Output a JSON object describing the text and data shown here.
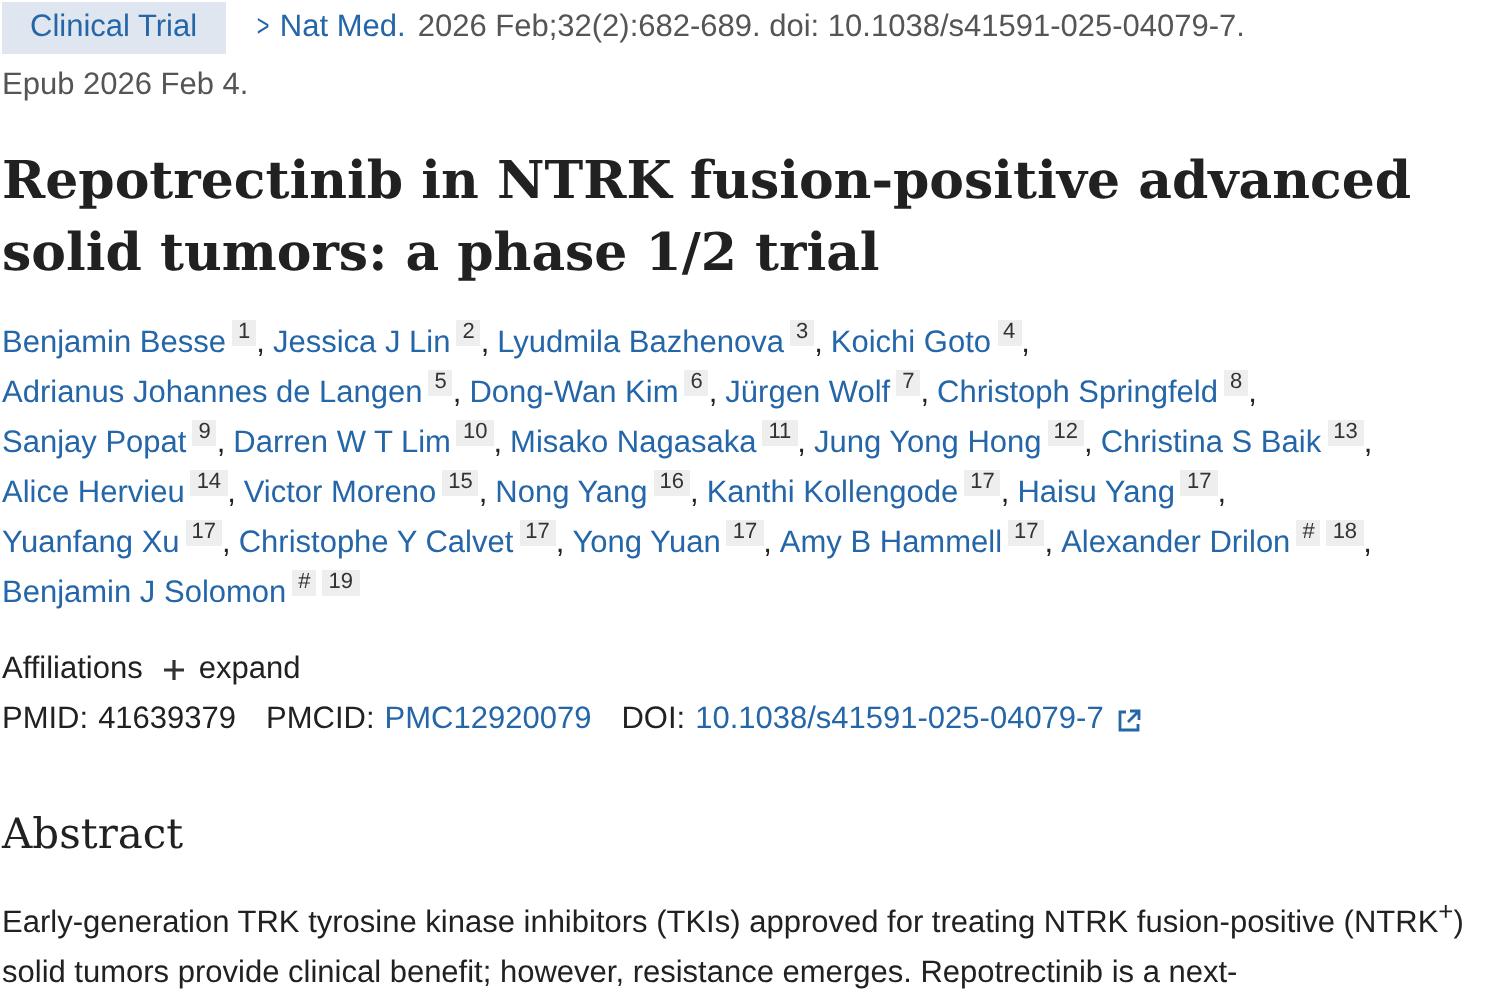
{
  "header": {
    "badge": "Clinical Trial",
    "chevron": ">",
    "journal": "Nat Med.",
    "citation": "2026 Feb;32(2):682-689. doi: 10.1038/s41591-025-04079-7.",
    "epub": "Epub 2026 Feb 4."
  },
  "title": "Repotrectinib in NTRK fusion-positive advanced solid tumors: a phase 1/2 trial",
  "author_lines": [
    [
      {
        "name": "Benjamin Besse",
        "marks": [
          "1"
        ],
        "separator": ","
      },
      {
        "name": "Jessica J Lin",
        "marks": [
          "2"
        ],
        "separator": ","
      },
      {
        "name": "Lyudmila Bazhenova",
        "marks": [
          "3"
        ],
        "separator": ","
      },
      {
        "name": "Koichi Goto",
        "marks": [
          "4"
        ],
        "separator": ","
      }
    ],
    [
      {
        "name": "Adrianus Johannes de Langen",
        "marks": [
          "5"
        ],
        "separator": ","
      },
      {
        "name": "Dong-Wan Kim",
        "marks": [
          "6"
        ],
        "separator": ","
      },
      {
        "name": "Jürgen Wolf",
        "marks": [
          "7"
        ],
        "separator": ","
      },
      {
        "name": "Christoph Springfeld",
        "marks": [
          "8"
        ],
        "separator": ","
      }
    ],
    [
      {
        "name": "Sanjay Popat",
        "marks": [
          "9"
        ],
        "separator": ","
      },
      {
        "name": "Darren W T Lim",
        "marks": [
          "10"
        ],
        "separator": ","
      },
      {
        "name": "Misako Nagasaka",
        "marks": [
          "11"
        ],
        "separator": ","
      },
      {
        "name": "Jung Yong Hong",
        "marks": [
          "12"
        ],
        "separator": ","
      },
      {
        "name": "Christina S Baik",
        "marks": [
          "13"
        ],
        "separator": ","
      }
    ],
    [
      {
        "name": "Alice Hervieu",
        "marks": [
          "14"
        ],
        "separator": ","
      },
      {
        "name": "Victor Moreno",
        "marks": [
          "15"
        ],
        "separator": ","
      },
      {
        "name": "Nong Yang",
        "marks": [
          "16"
        ],
        "separator": ","
      },
      {
        "name": "Kanthi Kollengode",
        "marks": [
          "17"
        ],
        "separator": ","
      },
      {
        "name": "Haisu Yang",
        "marks": [
          "17"
        ],
        "separator": ","
      }
    ],
    [
      {
        "name": "Yuanfang Xu",
        "marks": [
          "17"
        ],
        "separator": ","
      },
      {
        "name": "Christophe Y Calvet",
        "marks": [
          "17"
        ],
        "separator": ","
      },
      {
        "name": "Yong Yuan",
        "marks": [
          "17"
        ],
        "separator": ","
      },
      {
        "name": "Amy B Hammell",
        "marks": [
          "17"
        ],
        "separator": ","
      },
      {
        "name": "Alexander Drilon",
        "marks": [
          "#",
          "18"
        ],
        "separator": ","
      }
    ],
    [
      {
        "name": "Benjamin J Solomon",
        "marks": [
          "#",
          "19"
        ]
      }
    ]
  ],
  "affiliations": {
    "label": "Affiliations",
    "toggle": "expand",
    "expanded": false
  },
  "ids": {
    "pmid_label": "PMID:",
    "pmid": "41639379",
    "pmcid_label": "PMCID:",
    "pmcid": "PMC12920079",
    "doi_label": "DOI:",
    "doi": "10.1038/s41591-025-04079-7"
  },
  "abstract": {
    "heading": "Abstract",
    "text": "Early-generation TRK tyrosine kinase inhibitors (TKIs) approved for treating NTRK fusion-positive (NTRK$^{+}$) solid tumors provide clinical benefit; however, resistance emerges. Repotrectinib is a next-"
  }
}
